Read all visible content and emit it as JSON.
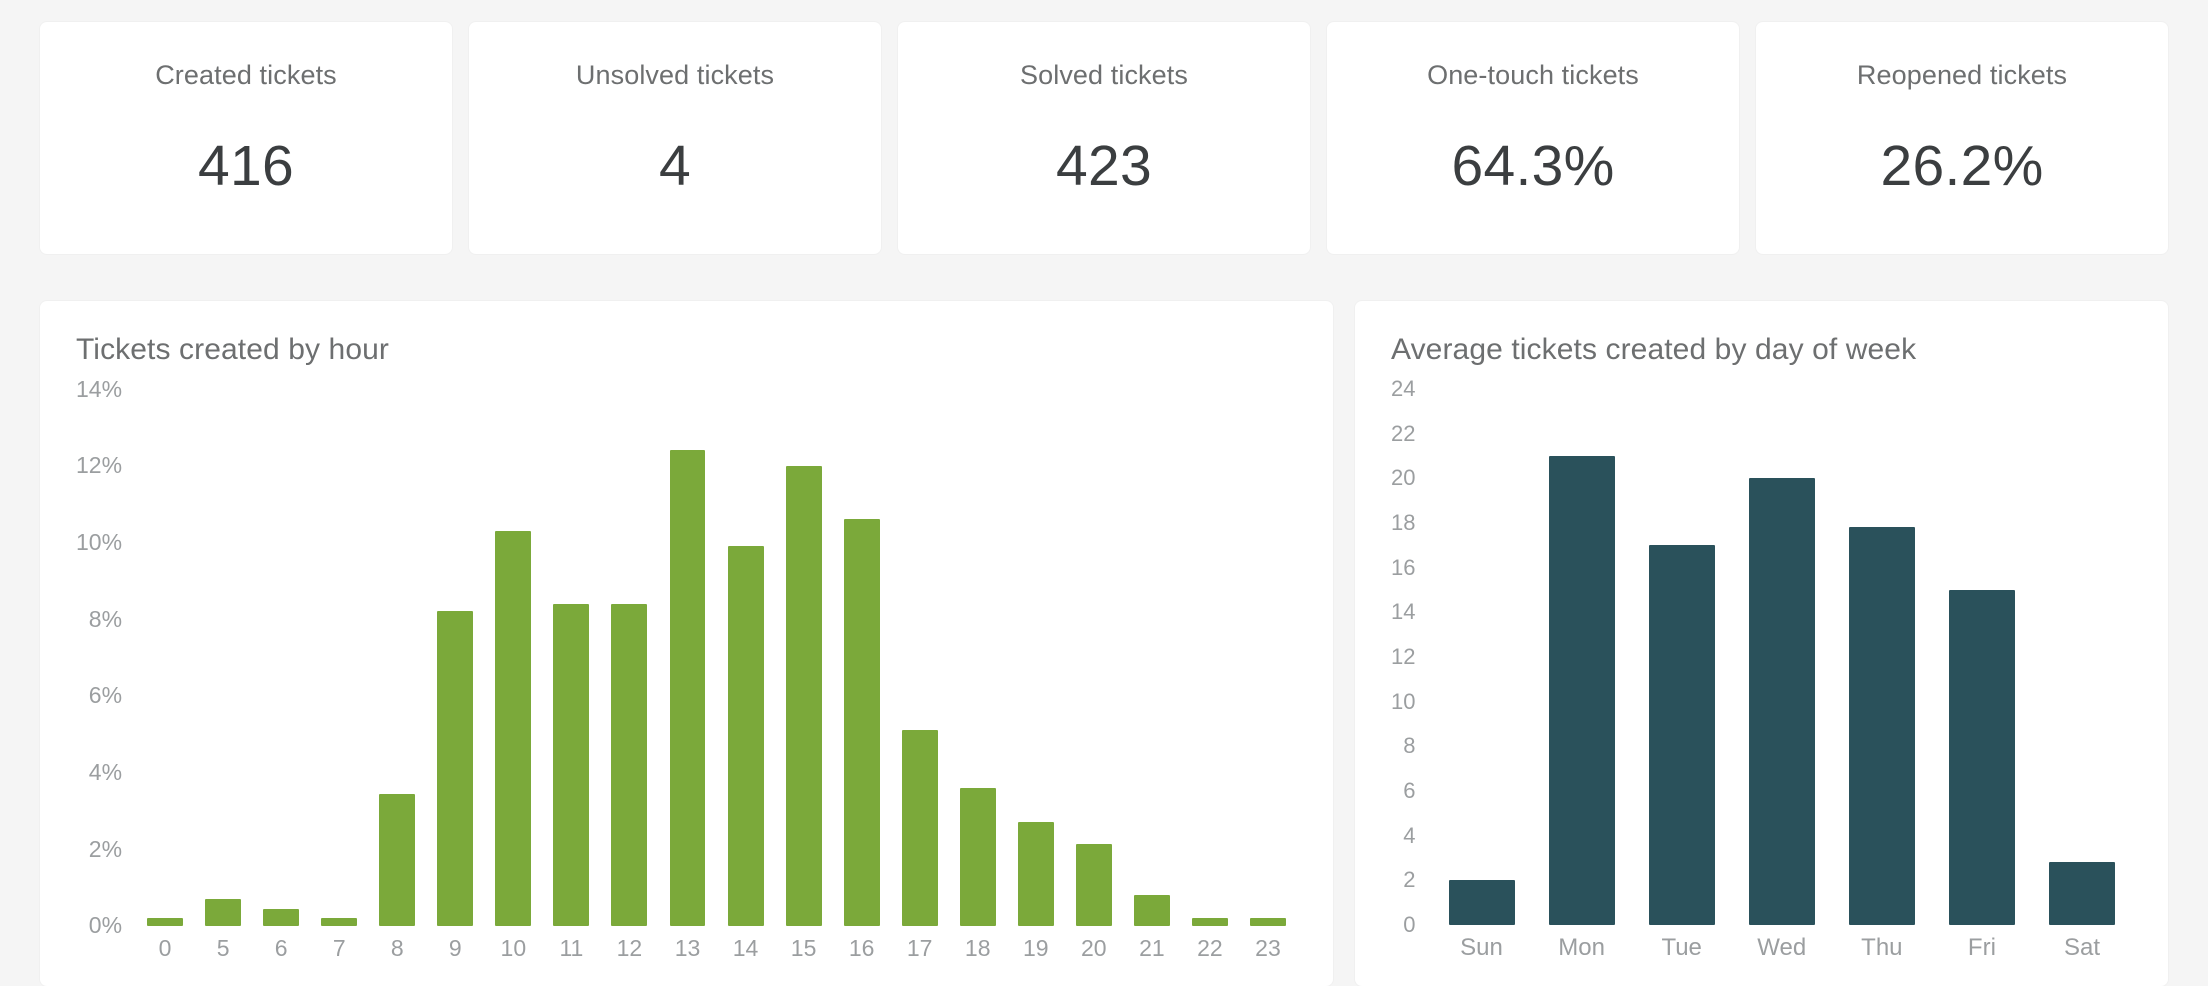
{
  "kpis": [
    {
      "label": "Created tickets",
      "value": "416"
    },
    {
      "label": "Unsolved tickets",
      "value": "4"
    },
    {
      "label": "Solved tickets",
      "value": "423"
    },
    {
      "label": "One-touch tickets",
      "value": "64.3%"
    },
    {
      "label": "Reopened tickets",
      "value": "26.2%"
    }
  ],
  "colors": {
    "page_background": "#f5f5f5",
    "card_background": "#ffffff",
    "bar_green": "#7ba93a",
    "bar_teal": "#2a515b",
    "label_text": "#6d6f70",
    "value_text": "#3b3e40",
    "axis_text": "#9b9ea0"
  },
  "chart_data": [
    {
      "type": "bar",
      "id": "tickets-by-hour",
      "title": "Tickets created by hour",
      "xlabel": "",
      "ylabel": "",
      "categories": [
        "0",
        "5",
        "6",
        "7",
        "8",
        "9",
        "10",
        "11",
        "12",
        "13",
        "14",
        "15",
        "16",
        "17",
        "18",
        "19",
        "20",
        "21",
        "22",
        "23"
      ],
      "values": [
        0.2,
        0.7,
        0.45,
        0.2,
        3.45,
        8.2,
        10.3,
        8.4,
        8.4,
        12.4,
        9.9,
        12.0,
        10.6,
        5.1,
        3.6,
        2.7,
        2.15,
        0.8,
        0.2,
        0.2
      ],
      "ylim": [
        0,
        14
      ],
      "ytick_values": [
        14,
        12,
        10,
        8,
        6,
        4,
        2,
        0
      ],
      "ytick_labels": [
        "14%",
        "12%",
        "10%",
        "8%",
        "6%",
        "4%",
        "2%",
        "0%"
      ],
      "value_format": "percent",
      "grid": false,
      "legend": "none",
      "bar_color": "#7ba93a"
    },
    {
      "type": "bar",
      "id": "average-tickets-by-day-of-week",
      "title": "Average tickets created by day of week",
      "xlabel": "",
      "ylabel": "",
      "categories": [
        "Sun",
        "Mon",
        "Tue",
        "Wed",
        "Thu",
        "Fri",
        "Sat"
      ],
      "values": [
        2.0,
        21.0,
        17.0,
        20.0,
        17.8,
        15.0,
        2.8
      ],
      "ylim": [
        0,
        24
      ],
      "ytick_values": [
        24,
        22,
        20,
        18,
        16,
        14,
        12,
        10,
        8,
        6,
        4,
        2,
        0
      ],
      "ytick_labels": [
        "24",
        "22",
        "20",
        "18",
        "16",
        "14",
        "12",
        "10",
        "8",
        "6",
        "4",
        "2",
        "0"
      ],
      "value_format": "number",
      "grid": false,
      "legend": "none",
      "bar_color": "#2a515b"
    }
  ]
}
